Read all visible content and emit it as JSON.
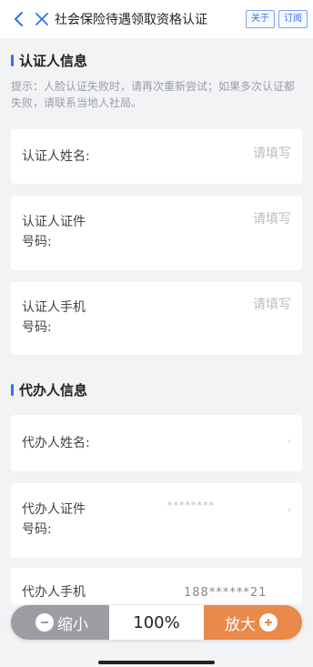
{
  "header": {
    "title": "社会保险待遇领取资格认证",
    "about_label": "关于",
    "subscribe_label": "订阅"
  },
  "certifier": {
    "section_title": "认证人信息",
    "hint": "提示：人脸认证失败时，请再次重新尝试；如果多次认证都失败，请联系当地人社局。",
    "fields": [
      {
        "label": "认证人姓名:",
        "placeholder": "请填写"
      },
      {
        "label": "认证人证件\n号码:",
        "placeholder": "请填写"
      },
      {
        "label": "认证人手机\n号码:",
        "placeholder": "请填写"
      }
    ]
  },
  "agent": {
    "section_title": "代办人信息",
    "fields": [
      {
        "label": "代办人姓名:",
        "value": ""
      },
      {
        "label": "代办人证件\n号码:",
        "value": "********"
      },
      {
        "label": "代办人手机",
        "value": "188******21"
      }
    ]
  },
  "zoom": {
    "out_label": "缩小",
    "level": "100%",
    "in_label": "放大"
  },
  "colors": {
    "accent": "#3470f0",
    "zoom_in": "#e9894a",
    "zoom_out": "#9b9da2"
  }
}
